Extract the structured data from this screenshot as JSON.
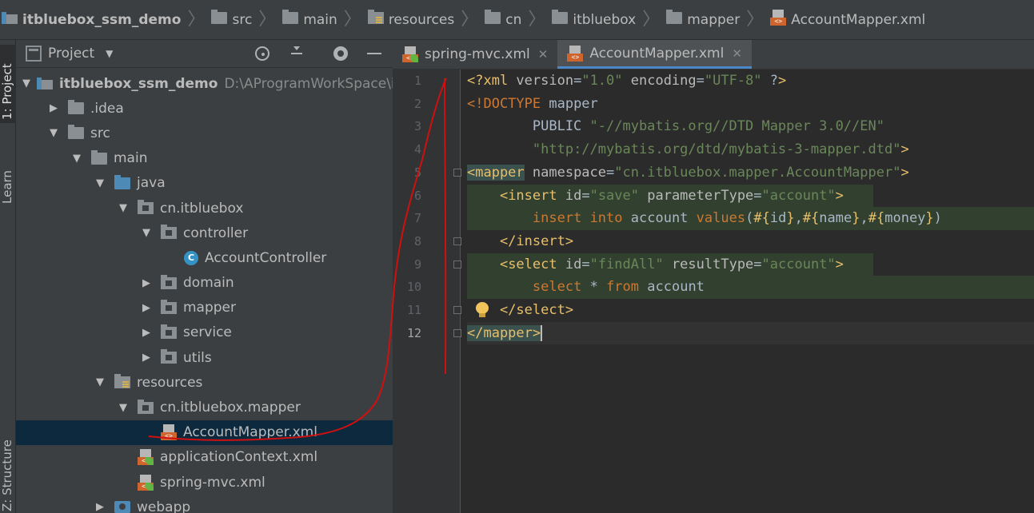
{
  "breadcrumb": [
    {
      "label": "itbluebox_ssm_demo",
      "icon": "project-icon"
    },
    {
      "label": "src",
      "icon": "folder-icon"
    },
    {
      "label": "main",
      "icon": "folder-icon"
    },
    {
      "label": "resources",
      "icon": "resources-folder-icon"
    },
    {
      "label": "cn",
      "icon": "folder-icon"
    },
    {
      "label": "itbluebox",
      "icon": "folder-icon"
    },
    {
      "label": "mapper",
      "icon": "folder-icon"
    },
    {
      "label": "AccountMapper.xml",
      "icon": "xml-file-icon"
    }
  ],
  "toolstrip": {
    "project_tab": "1: Project",
    "learn_tab": "Learn",
    "structure_tab": "Z: Structure"
  },
  "project_panel": {
    "title": "Project",
    "tree": [
      {
        "label": "itbluebox_ssm_demo",
        "path": "D:\\AProgramWorkSpace\\idea",
        "indent": 0,
        "arrow": "▼",
        "icon": "project"
      },
      {
        "label": ".idea",
        "indent": 1,
        "arrow": "▶",
        "icon": "folder"
      },
      {
        "label": "src",
        "indent": 1,
        "arrow": "▼",
        "icon": "folder"
      },
      {
        "label": "main",
        "indent": 2,
        "arrow": "▼",
        "icon": "folder"
      },
      {
        "label": "java",
        "indent": 3,
        "arrow": "▼",
        "icon": "folder-blue"
      },
      {
        "label": "cn.itbluebox",
        "indent": 4,
        "arrow": "▼",
        "icon": "package"
      },
      {
        "label": "controller",
        "indent": 5,
        "arrow": "▼",
        "icon": "package"
      },
      {
        "label": "AccountController",
        "indent": 6,
        "arrow": "",
        "icon": "class"
      },
      {
        "label": "domain",
        "indent": 5,
        "arrow": "▶",
        "icon": "package"
      },
      {
        "label": "mapper",
        "indent": 5,
        "arrow": "▶",
        "icon": "package"
      },
      {
        "label": "service",
        "indent": 5,
        "arrow": "▶",
        "icon": "package"
      },
      {
        "label": "utils",
        "indent": 5,
        "arrow": "▶",
        "icon": "package"
      },
      {
        "label": "resources",
        "indent": 3,
        "arrow": "▼",
        "icon": "resources"
      },
      {
        "label": "cn.itbluebox.mapper",
        "indent": 4,
        "arrow": "▼",
        "icon": "package"
      },
      {
        "label": "AccountMapper.xml",
        "indent": 5,
        "arrow": "",
        "icon": "xml",
        "selected": true
      },
      {
        "label": "applicationContext.xml",
        "indent": 4,
        "arrow": "",
        "icon": "spring-xml"
      },
      {
        "label": "spring-mvc.xml",
        "indent": 4,
        "arrow": "",
        "icon": "spring-xml"
      },
      {
        "label": "webapp",
        "indent": 3,
        "arrow": "▶",
        "icon": "webapp"
      }
    ]
  },
  "tabs": [
    {
      "label": "spring-mvc.xml",
      "active": false
    },
    {
      "label": "AccountMapper.xml",
      "active": true
    }
  ],
  "editor": {
    "line_numbers": [
      "1",
      "2",
      "3",
      "4",
      "5",
      "6",
      "7",
      "8",
      "9",
      "10",
      "11",
      "12"
    ],
    "lines": [
      "<?xml version=\"1.0\" encoding=\"UTF-8\" ?>",
      "<!DOCTYPE mapper",
      "        PUBLIC \"-//mybatis.org//DTD Mapper 3.0//EN\"",
      "        \"http://mybatis.org/dtd/mybatis-3-mapper.dtd\">",
      "<mapper namespace=\"cn.itbluebox.mapper.AccountMapper\">",
      "    <insert id=\"save\" parameterType=\"account\">",
      "        insert into account values(#{id},#{name},#{money})",
      "    </insert>",
      "    <select id=\"findAll\" resultType=\"account\">",
      "        select * from account",
      "    </select>",
      "</mapper>"
    ]
  },
  "colors": {
    "annotation": "#d01010",
    "selection": "#0d293e",
    "tab_underline": "#4a88c7"
  }
}
